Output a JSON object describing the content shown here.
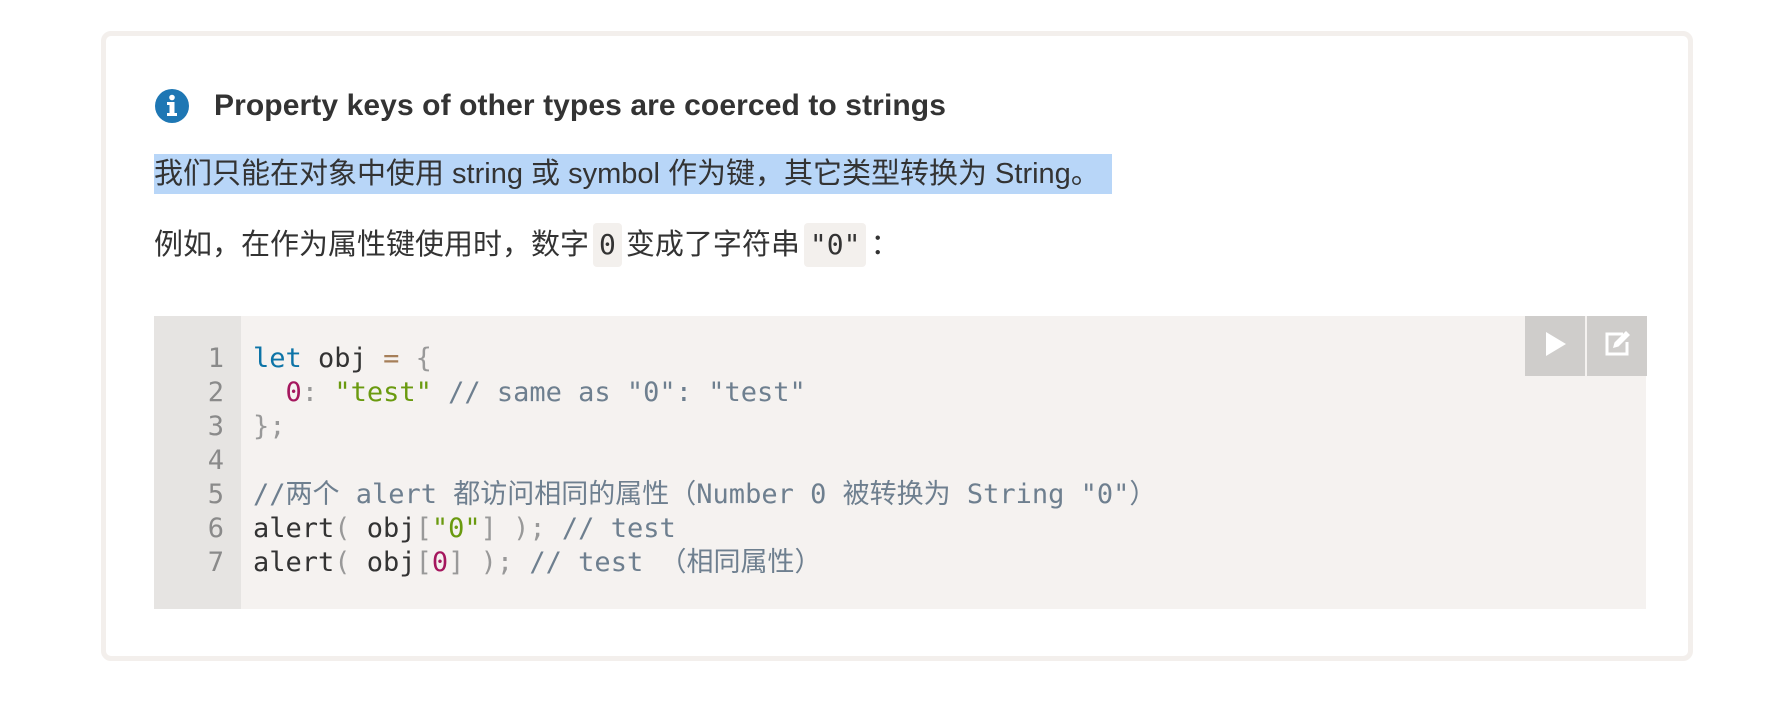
{
  "note": {
    "title": "Property keys of other types are coerced to strings",
    "icon": "info-icon",
    "accent_color": "#1e77b4"
  },
  "paragraphs": {
    "p1": "我们只能在对象中使用 string 或 symbol 作为键，其它类型转换为 String。",
    "p2_before": "例如，在作为属性键使用时，数字",
    "p2_code1": "0",
    "p2_middle": "变成了字符串",
    "p2_code2": "\"0\"",
    "p2_after": "："
  },
  "code": {
    "line_numbers": [
      "1",
      "2",
      "3",
      "4",
      "5",
      "6",
      "7"
    ],
    "lines": [
      [
        {
          "t": "let",
          "c": "kw"
        },
        {
          "t": " obj ",
          "c": ""
        },
        {
          "t": "=",
          "c": "op"
        },
        {
          "t": " ",
          "c": ""
        },
        {
          "t": "{",
          "c": "punc"
        }
      ],
      [
        {
          "t": "  ",
          "c": ""
        },
        {
          "t": "0",
          "c": "num"
        },
        {
          "t": ":",
          "c": "punc"
        },
        {
          "t": " ",
          "c": ""
        },
        {
          "t": "\"test\"",
          "c": "str"
        },
        {
          "t": " // same as \"0\": \"test\"",
          "c": "cmt"
        }
      ],
      [
        {
          "t": "};",
          "c": "punc"
        }
      ],
      [],
      [
        {
          "t": "//两个 alert 都访问相同的属性（Number 0 被转换为 String \"0\"）",
          "c": "cmt"
        }
      ],
      [
        {
          "t": "alert",
          "c": ""
        },
        {
          "t": "(",
          "c": "punc"
        },
        {
          "t": " obj",
          "c": ""
        },
        {
          "t": "[",
          "c": "punc"
        },
        {
          "t": "\"0\"",
          "c": "str"
        },
        {
          "t": "]",
          "c": "punc"
        },
        {
          "t": " ",
          "c": ""
        },
        {
          "t": ");",
          "c": "punc"
        },
        {
          "t": " // test",
          "c": "cmt"
        }
      ],
      [
        {
          "t": "alert",
          "c": ""
        },
        {
          "t": "(",
          "c": "punc"
        },
        {
          "t": " obj",
          "c": ""
        },
        {
          "t": "[",
          "c": "punc"
        },
        {
          "t": "0",
          "c": "num"
        },
        {
          "t": "]",
          "c": "punc"
        },
        {
          "t": " ",
          "c": ""
        },
        {
          "t": ");",
          "c": "punc"
        },
        {
          "t": " // test （相同属性）",
          "c": "cmt"
        }
      ]
    ]
  },
  "toolbar": {
    "run_icon": "play-icon",
    "edit_icon": "edit-icon"
  }
}
